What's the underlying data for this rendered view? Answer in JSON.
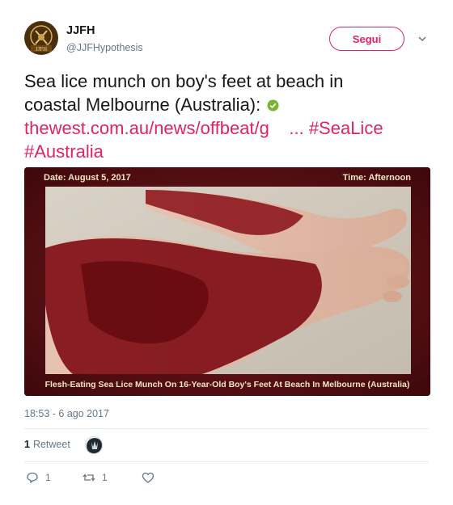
{
  "author": {
    "name": "JJFH",
    "handle": "@JJFHypothesis",
    "avatar_text": "JJFH"
  },
  "follow_label": "Segui",
  "tweet": {
    "text_line1": "Sea lice munch on boy's feet at beach in",
    "text_line2": "coastal Melbourne (Australia):",
    "link": "thewest.com.au/news/offbeat/g",
    "ellipsis": "...",
    "hashtag1": "#SeaLice",
    "hashtag2": "#Australia"
  },
  "media": {
    "date_label": "Date: August 5, 2017",
    "time_label": "Time: Afternoon",
    "caption": "Flesh-Eating Sea Lice Munch On 16-Year-Old Boy's Feet At Beach In Melbourne (Australia)"
  },
  "timestamp": "18:53 - 6 ago 2017",
  "retweet_count": "1",
  "retweet_label": "Retweet",
  "actions": {
    "reply_count": "1",
    "retweet_count": "1",
    "like_count": ""
  },
  "colors": {
    "accent": "#e0245e",
    "muted": "#657786",
    "verified": "#79b530"
  },
  "icons": [
    "reply-icon",
    "retweet-icon",
    "like-icon",
    "verified-icon",
    "chevron-down-icon"
  ]
}
